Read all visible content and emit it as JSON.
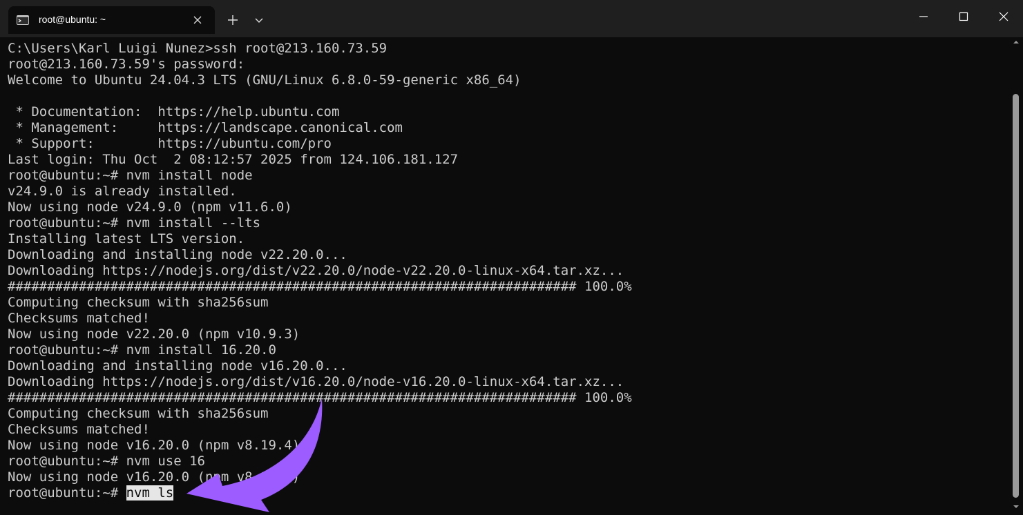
{
  "window": {
    "tab_title": "root@ubuntu: ~",
    "tab_icon": "terminal-icon",
    "controls": [
      "minimize-icon",
      "maximize-icon",
      "close-icon"
    ]
  },
  "terminal": {
    "lines": [
      "C:\\Users\\Karl Luigi Nunez>ssh root@213.160.73.59",
      "root@213.160.73.59's password:",
      "Welcome to Ubuntu 24.04.3 LTS (GNU/Linux 6.8.0-59-generic x86_64)",
      "",
      " * Documentation:  https://help.ubuntu.com",
      " * Management:     https://landscape.canonical.com",
      " * Support:        https://ubuntu.com/pro",
      "Last login: Thu Oct  2 08:12:57 2025 from 124.106.181.127",
      "root@ubuntu:~# nvm install node",
      "v24.9.0 is already installed.",
      "Now using node v24.9.0 (npm v11.6.0)",
      "root@ubuntu:~# nvm install --lts",
      "Installing latest LTS version.",
      "Downloading and installing node v22.20.0...",
      "Downloading https://nodejs.org/dist/v22.20.0/node-v22.20.0-linux-x64.tar.xz...",
      "######################################################################## 100.0%",
      "Computing checksum with sha256sum",
      "Checksums matched!",
      "Now using node v22.20.0 (npm v10.9.3)",
      "root@ubuntu:~# nvm install 16.20.0",
      "Downloading and installing node v16.20.0...",
      "Downloading https://nodejs.org/dist/v16.20.0/node-v16.20.0-linux-x64.tar.xz...",
      "######################################################################## 100.0%",
      "Computing checksum with sha256sum",
      "Checksums matched!",
      "Now using node v16.20.0 (npm v8.19.4)",
      "root@ubuntu:~# nvm use 16",
      "Now using node v16.20.0 (npm v8.19.4)"
    ],
    "prompt": "root@ubuntu:~# ",
    "current_command": "nvm ls"
  },
  "annotation": {
    "arrow_color": "#9d5cff",
    "arrow_icon": "curved-arrow-icon"
  },
  "colors": {
    "terminal_bg": "#0c0c0c",
    "terminal_fg": "#cccccc",
    "titlebar_bg": "#1f1f1f"
  }
}
